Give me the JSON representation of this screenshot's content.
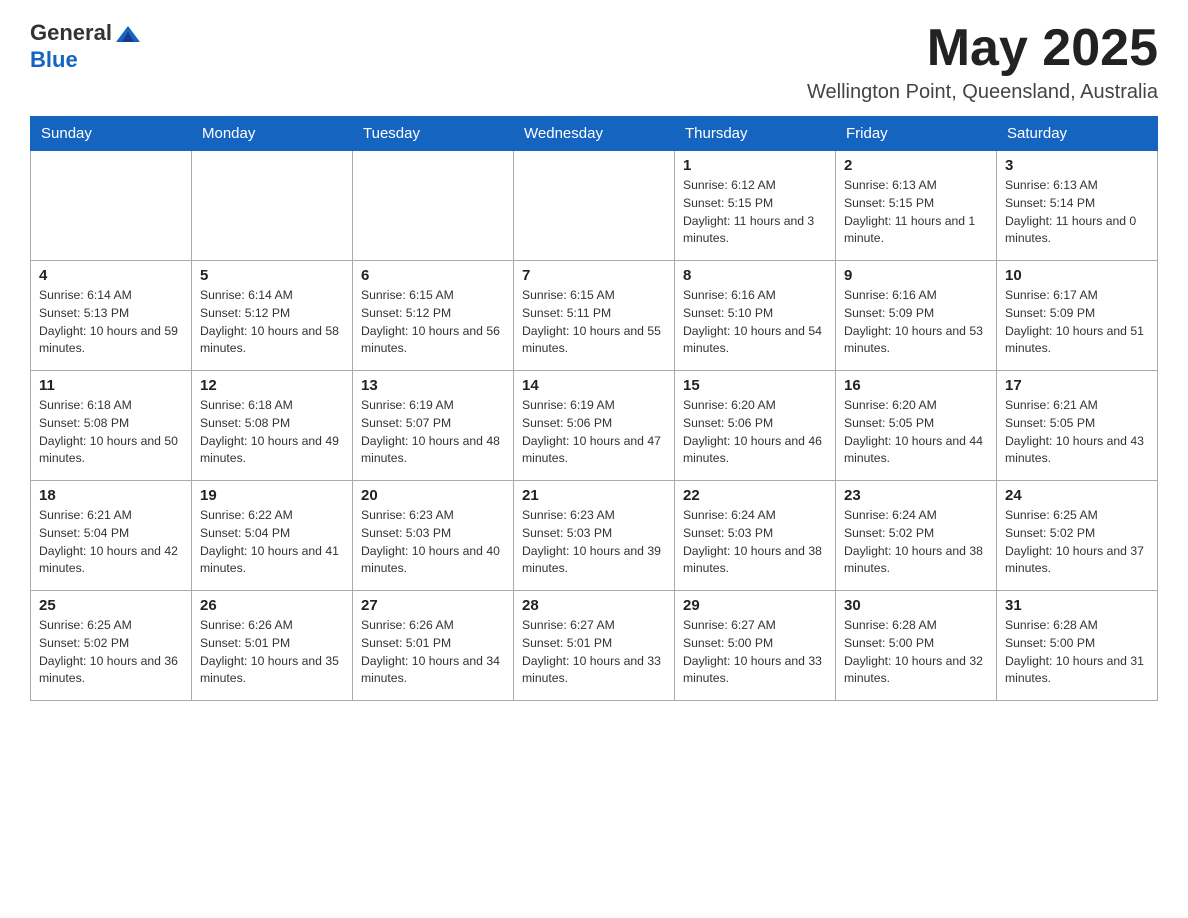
{
  "header": {
    "logo_general": "General",
    "logo_blue": "Blue",
    "month": "May 2025",
    "location": "Wellington Point, Queensland, Australia"
  },
  "weekdays": [
    "Sunday",
    "Monday",
    "Tuesday",
    "Wednesday",
    "Thursday",
    "Friday",
    "Saturday"
  ],
  "weeks": [
    [
      {
        "day": "",
        "info": ""
      },
      {
        "day": "",
        "info": ""
      },
      {
        "day": "",
        "info": ""
      },
      {
        "day": "",
        "info": ""
      },
      {
        "day": "1",
        "info": "Sunrise: 6:12 AM\nSunset: 5:15 PM\nDaylight: 11 hours and 3 minutes."
      },
      {
        "day": "2",
        "info": "Sunrise: 6:13 AM\nSunset: 5:15 PM\nDaylight: 11 hours and 1 minute."
      },
      {
        "day": "3",
        "info": "Sunrise: 6:13 AM\nSunset: 5:14 PM\nDaylight: 11 hours and 0 minutes."
      }
    ],
    [
      {
        "day": "4",
        "info": "Sunrise: 6:14 AM\nSunset: 5:13 PM\nDaylight: 10 hours and 59 minutes."
      },
      {
        "day": "5",
        "info": "Sunrise: 6:14 AM\nSunset: 5:12 PM\nDaylight: 10 hours and 58 minutes."
      },
      {
        "day": "6",
        "info": "Sunrise: 6:15 AM\nSunset: 5:12 PM\nDaylight: 10 hours and 56 minutes."
      },
      {
        "day": "7",
        "info": "Sunrise: 6:15 AM\nSunset: 5:11 PM\nDaylight: 10 hours and 55 minutes."
      },
      {
        "day": "8",
        "info": "Sunrise: 6:16 AM\nSunset: 5:10 PM\nDaylight: 10 hours and 54 minutes."
      },
      {
        "day": "9",
        "info": "Sunrise: 6:16 AM\nSunset: 5:09 PM\nDaylight: 10 hours and 53 minutes."
      },
      {
        "day": "10",
        "info": "Sunrise: 6:17 AM\nSunset: 5:09 PM\nDaylight: 10 hours and 51 minutes."
      }
    ],
    [
      {
        "day": "11",
        "info": "Sunrise: 6:18 AM\nSunset: 5:08 PM\nDaylight: 10 hours and 50 minutes."
      },
      {
        "day": "12",
        "info": "Sunrise: 6:18 AM\nSunset: 5:08 PM\nDaylight: 10 hours and 49 minutes."
      },
      {
        "day": "13",
        "info": "Sunrise: 6:19 AM\nSunset: 5:07 PM\nDaylight: 10 hours and 48 minutes."
      },
      {
        "day": "14",
        "info": "Sunrise: 6:19 AM\nSunset: 5:06 PM\nDaylight: 10 hours and 47 minutes."
      },
      {
        "day": "15",
        "info": "Sunrise: 6:20 AM\nSunset: 5:06 PM\nDaylight: 10 hours and 46 minutes."
      },
      {
        "day": "16",
        "info": "Sunrise: 6:20 AM\nSunset: 5:05 PM\nDaylight: 10 hours and 44 minutes."
      },
      {
        "day": "17",
        "info": "Sunrise: 6:21 AM\nSunset: 5:05 PM\nDaylight: 10 hours and 43 minutes."
      }
    ],
    [
      {
        "day": "18",
        "info": "Sunrise: 6:21 AM\nSunset: 5:04 PM\nDaylight: 10 hours and 42 minutes."
      },
      {
        "day": "19",
        "info": "Sunrise: 6:22 AM\nSunset: 5:04 PM\nDaylight: 10 hours and 41 minutes."
      },
      {
        "day": "20",
        "info": "Sunrise: 6:23 AM\nSunset: 5:03 PM\nDaylight: 10 hours and 40 minutes."
      },
      {
        "day": "21",
        "info": "Sunrise: 6:23 AM\nSunset: 5:03 PM\nDaylight: 10 hours and 39 minutes."
      },
      {
        "day": "22",
        "info": "Sunrise: 6:24 AM\nSunset: 5:03 PM\nDaylight: 10 hours and 38 minutes."
      },
      {
        "day": "23",
        "info": "Sunrise: 6:24 AM\nSunset: 5:02 PM\nDaylight: 10 hours and 38 minutes."
      },
      {
        "day": "24",
        "info": "Sunrise: 6:25 AM\nSunset: 5:02 PM\nDaylight: 10 hours and 37 minutes."
      }
    ],
    [
      {
        "day": "25",
        "info": "Sunrise: 6:25 AM\nSunset: 5:02 PM\nDaylight: 10 hours and 36 minutes."
      },
      {
        "day": "26",
        "info": "Sunrise: 6:26 AM\nSunset: 5:01 PM\nDaylight: 10 hours and 35 minutes."
      },
      {
        "day": "27",
        "info": "Sunrise: 6:26 AM\nSunset: 5:01 PM\nDaylight: 10 hours and 34 minutes."
      },
      {
        "day": "28",
        "info": "Sunrise: 6:27 AM\nSunset: 5:01 PM\nDaylight: 10 hours and 33 minutes."
      },
      {
        "day": "29",
        "info": "Sunrise: 6:27 AM\nSunset: 5:00 PM\nDaylight: 10 hours and 33 minutes."
      },
      {
        "day": "30",
        "info": "Sunrise: 6:28 AM\nSunset: 5:00 PM\nDaylight: 10 hours and 32 minutes."
      },
      {
        "day": "31",
        "info": "Sunrise: 6:28 AM\nSunset: 5:00 PM\nDaylight: 10 hours and 31 minutes."
      }
    ]
  ]
}
